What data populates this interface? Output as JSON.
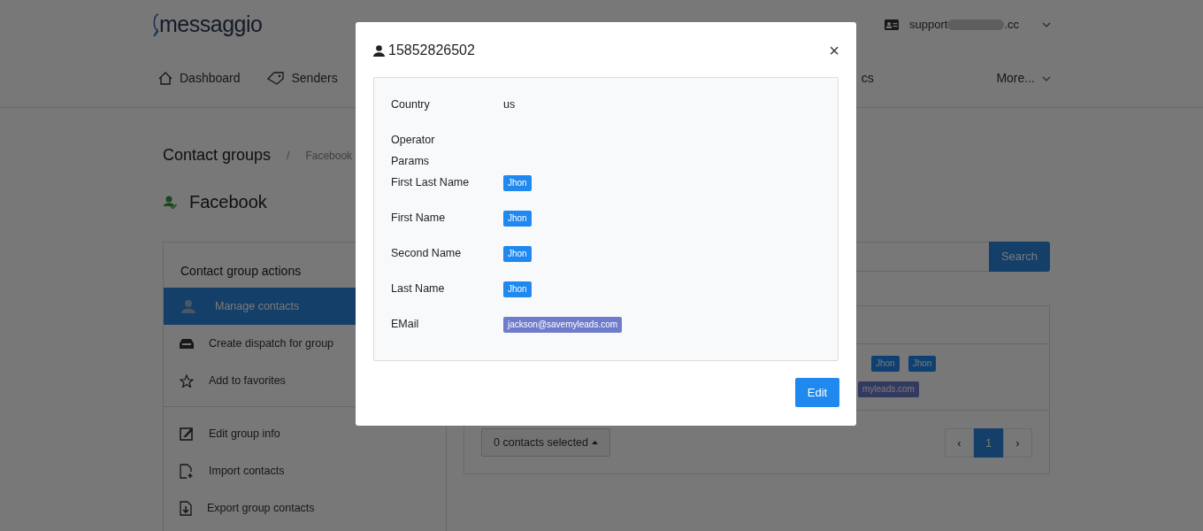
{
  "header": {
    "logo": "messaggio",
    "account_start": "support",
    "account_end": ".cc"
  },
  "nav": [
    {
      "label": "Dashboard"
    },
    {
      "label": "Senders"
    },
    {
      "label": "cs"
    }
  ],
  "nav_more": "More...",
  "breadcrumb": [
    "Contact groups",
    "Facebook"
  ],
  "breadcrumb_separator": "/",
  "group_title": "Facebook",
  "actions": {
    "title": "Contact group actions",
    "sections": [
      [
        {
          "label": "Manage contacts",
          "selected": true
        },
        {
          "label": "Create dispatch for group",
          "selected": false
        },
        {
          "label": "Add to favorites",
          "selected": false
        }
      ],
      [
        {
          "label": "Edit group info",
          "selected": false
        },
        {
          "label": "Import contacts",
          "selected": false
        },
        {
          "label": "Export group contacts",
          "selected": false
        }
      ]
    ]
  },
  "search_button": "Search",
  "table": {
    "name_badges": [
      "Jhon",
      "Jhon"
    ],
    "email_badge": "myleads.com",
    "selection_dropdown": "0 contacts selected",
    "prev": "‹",
    "next": "›",
    "pages": [
      {
        "label": "1",
        "selected": true
      }
    ]
  },
  "modal": {
    "title": "15852826502",
    "close": "×",
    "button": "Edit",
    "fields": [
      {
        "label": "Country",
        "kind": "text",
        "value": "us"
      },
      {
        "label": "Operator Params",
        "kind": "empty"
      },
      {
        "label": "First Last Name",
        "kind": "badge",
        "value": "Jhon"
      },
      {
        "label": "First Name",
        "kind": "badge",
        "value": "Jhon"
      },
      {
        "label": "Second Name",
        "kind": "badge",
        "value": "Jhon"
      },
      {
        "label": "Last Name",
        "kind": "badge",
        "value": "Jhon"
      },
      {
        "label": "EMail",
        "kind": "email",
        "value": "jackson@savemyleads.com"
      }
    ]
  }
}
